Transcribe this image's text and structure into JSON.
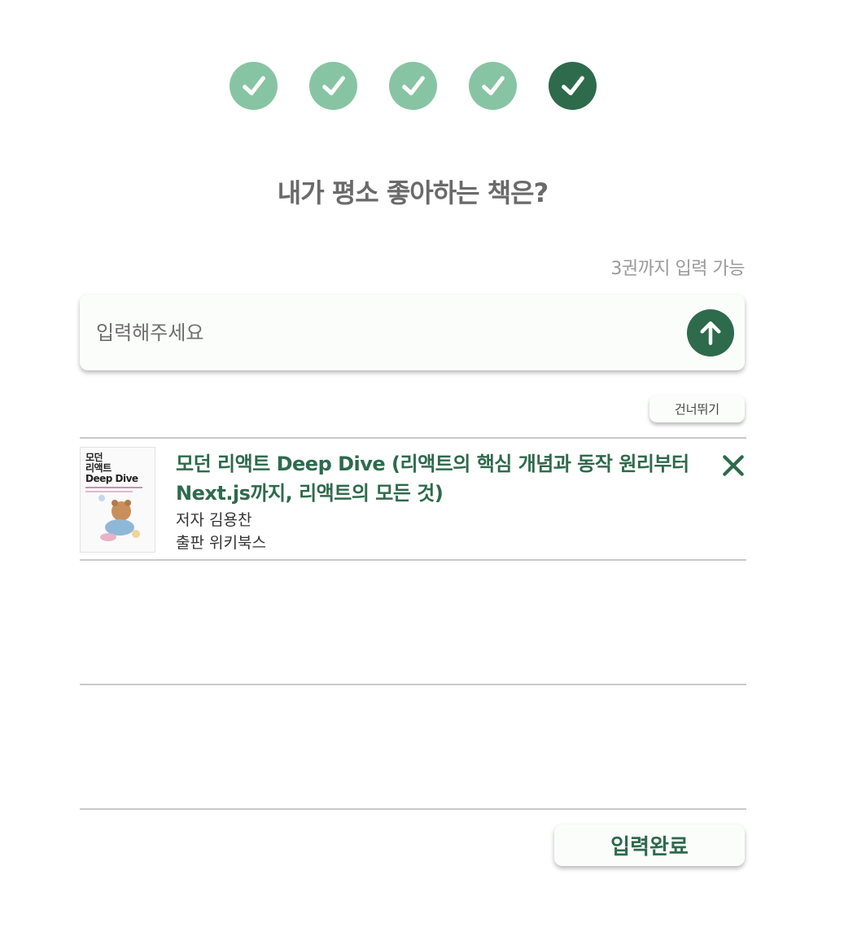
{
  "progress": {
    "steps": [
      {
        "state": "completed",
        "icon": "check-icon"
      },
      {
        "state": "completed",
        "icon": "check-icon"
      },
      {
        "state": "completed",
        "icon": "check-icon"
      },
      {
        "state": "completed",
        "icon": "check-icon"
      },
      {
        "state": "current",
        "icon": "check-icon"
      }
    ]
  },
  "question": {
    "title": "내가 평소 좋아하는 책은?",
    "limit_note": "3권까지 입력 가능"
  },
  "search": {
    "value": "",
    "placeholder": "입력해주세요",
    "submit_icon": "arrow-up-icon"
  },
  "skip_label": "건너뛰기",
  "selected_books": [
    {
      "title": "모던 리액트 Deep Dive (리액트의 핵심 개념과 동작 원리부터 Next.js까지, 리액트의 모든 것)",
      "author": "저자 김용찬",
      "publisher": "출판 위키북스",
      "cover_text": "모던\n리액트\nDeep Dive",
      "remove_icon": "close-icon"
    }
  ],
  "submit_label": "입력완료",
  "colors": {
    "accent": "#2e6a4c",
    "step_done": "#87c4a4",
    "title_text": "#6a6a6a",
    "hint_text": "#9a9a9a"
  }
}
